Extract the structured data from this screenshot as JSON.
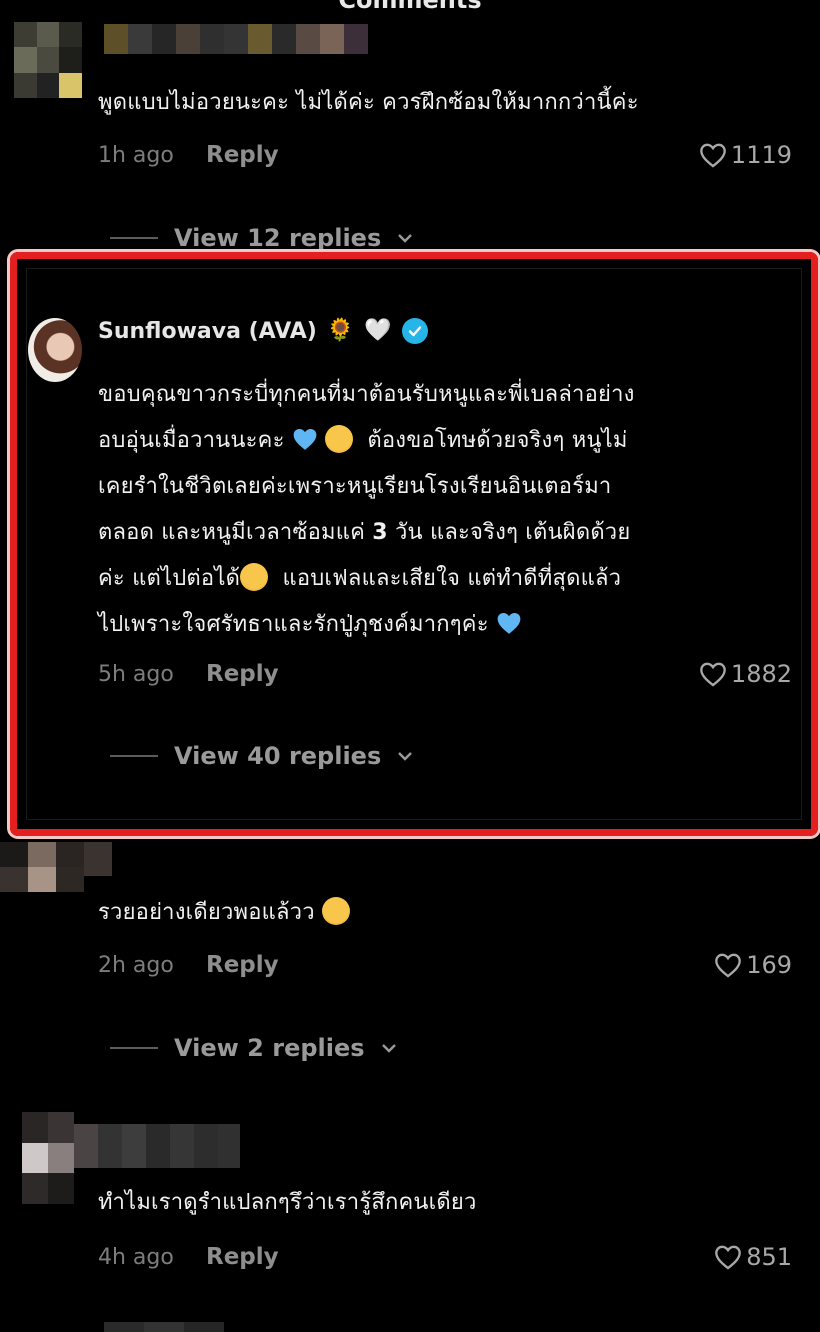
{
  "header": {
    "title": "Comments"
  },
  "comments": [
    {
      "text": "พูดแบบไม่อวยนะคะ ไม่ได้ค่ะ ควรฝึกซ้อมให้มากกว่านี้ค่ะ",
      "time": "1h ago",
      "reply_label": "Reply",
      "likes": "1119",
      "view_replies": "View 12 replies"
    },
    {
      "username": "Sunflowava (AVA)",
      "name_emojis": [
        "🌻",
        "🤍"
      ],
      "verified_icon": "verified-badge-icon",
      "text_lines": [
        "ขอบคุณขาวกระบี่ทุกคนที่มาต้อนรับหนูและพี่เบลล่าอย่าง",
        "อบอุ่นเมื่อวานนะคะ",
        "ต้องขอโทษด้วยจริงๆ หนูไม่",
        "เคยรำในชีวิตเลยค่ะเพราะหนูเรียนโรงเรียนอินเตอร์มา",
        "ตลอด และหนูมีเวลาซ้อมแค่",
        "3",
        "วัน และจริงๆ เต้นผิดด้วย",
        "ค่ะ แต่ไปต่อได้",
        "แอบเฟลและเสียใจ แต่ทำดีที่สุดแล้ว",
        "ไปเพราะใจศรัทธาและรักปู่ภุชงค์มากๆค่ะ"
      ],
      "time": "5h ago",
      "reply_label": "Reply",
      "likes": "1882",
      "view_replies": "View 40 replies"
    },
    {
      "text": "รวยอย่างเดียวพอแล้วว",
      "time": "2h ago",
      "reply_label": "Reply",
      "likes": "169",
      "view_replies": "View 2 replies"
    },
    {
      "text": "ทำไมเราดูรำแปลกๆรึว่าเรารู้สึกคนเดียว",
      "time": "4h ago",
      "reply_label": "Reply",
      "likes": "851"
    }
  ],
  "colors": {
    "highlight_border": "#e31f1f",
    "verified": "#25b5e8",
    "heart_blue": "#5fb6f2"
  }
}
